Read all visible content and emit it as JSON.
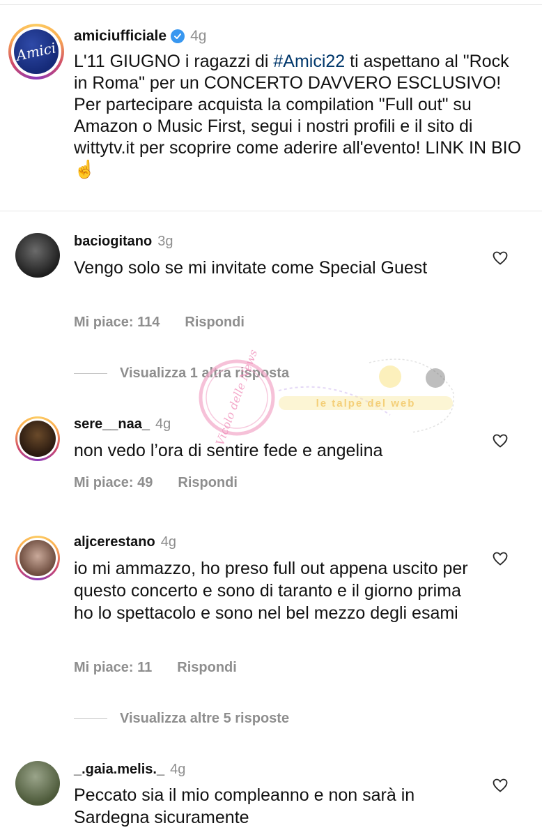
{
  "caption": {
    "username": "amiciufficiale",
    "time": "4g",
    "text_before_hashtag": "L'11 GIUGNO i ragazzi di ",
    "hashtag": "#Amici22",
    "text_after_hashtag": " ti aspettano al \"Rock in Roma\" per un CONCERTO DAVVERO ESCLUSIVO! Per partecipare acquista la compilation \"Full out\" su Amazon o Music First, segui i nostri profili e il sito di wittytv.it per scoprire come aderire all'evento! LINK IN BIO ☝️",
    "avatar_logo": "Amici"
  },
  "comments": [
    {
      "username": "baciogitano",
      "time": "3g",
      "text": "Vengo solo se mi invitate come Special Guest",
      "likes": "Mi piace: 114",
      "reply": "Rispondi",
      "view_replies": "Visualizza 1 altra risposta"
    },
    {
      "username": "sere__naa_",
      "time": "4g",
      "text": "non vedo l’ora di sentire fede e angelina",
      "likes": "Mi piace: 49",
      "reply": "Rispondi"
    },
    {
      "username": "aljcerestano",
      "time": "4g",
      "text": "io mi ammazzo, ho preso full out appena uscito per questo concerto e sono di taranto e il giorno prima ho lo spettacolo e sono nel bel mezzo degli esami",
      "likes": "Mi piace: 11",
      "reply": "Rispondi",
      "view_replies": "Visualizza altre 5 risposte"
    },
    {
      "username": "_.gaia.melis._",
      "time": "4g",
      "text": "Peccato sia il mio compleanno e non sarà in Sardegna sicuramente"
    }
  ],
  "watermark": {
    "stamp": "Vicolo delle News",
    "banner": "le talpe del web"
  },
  "colors": {
    "verified": "#3897f0",
    "hashtag": "#00376b",
    "muted": "#8e8e8e"
  }
}
